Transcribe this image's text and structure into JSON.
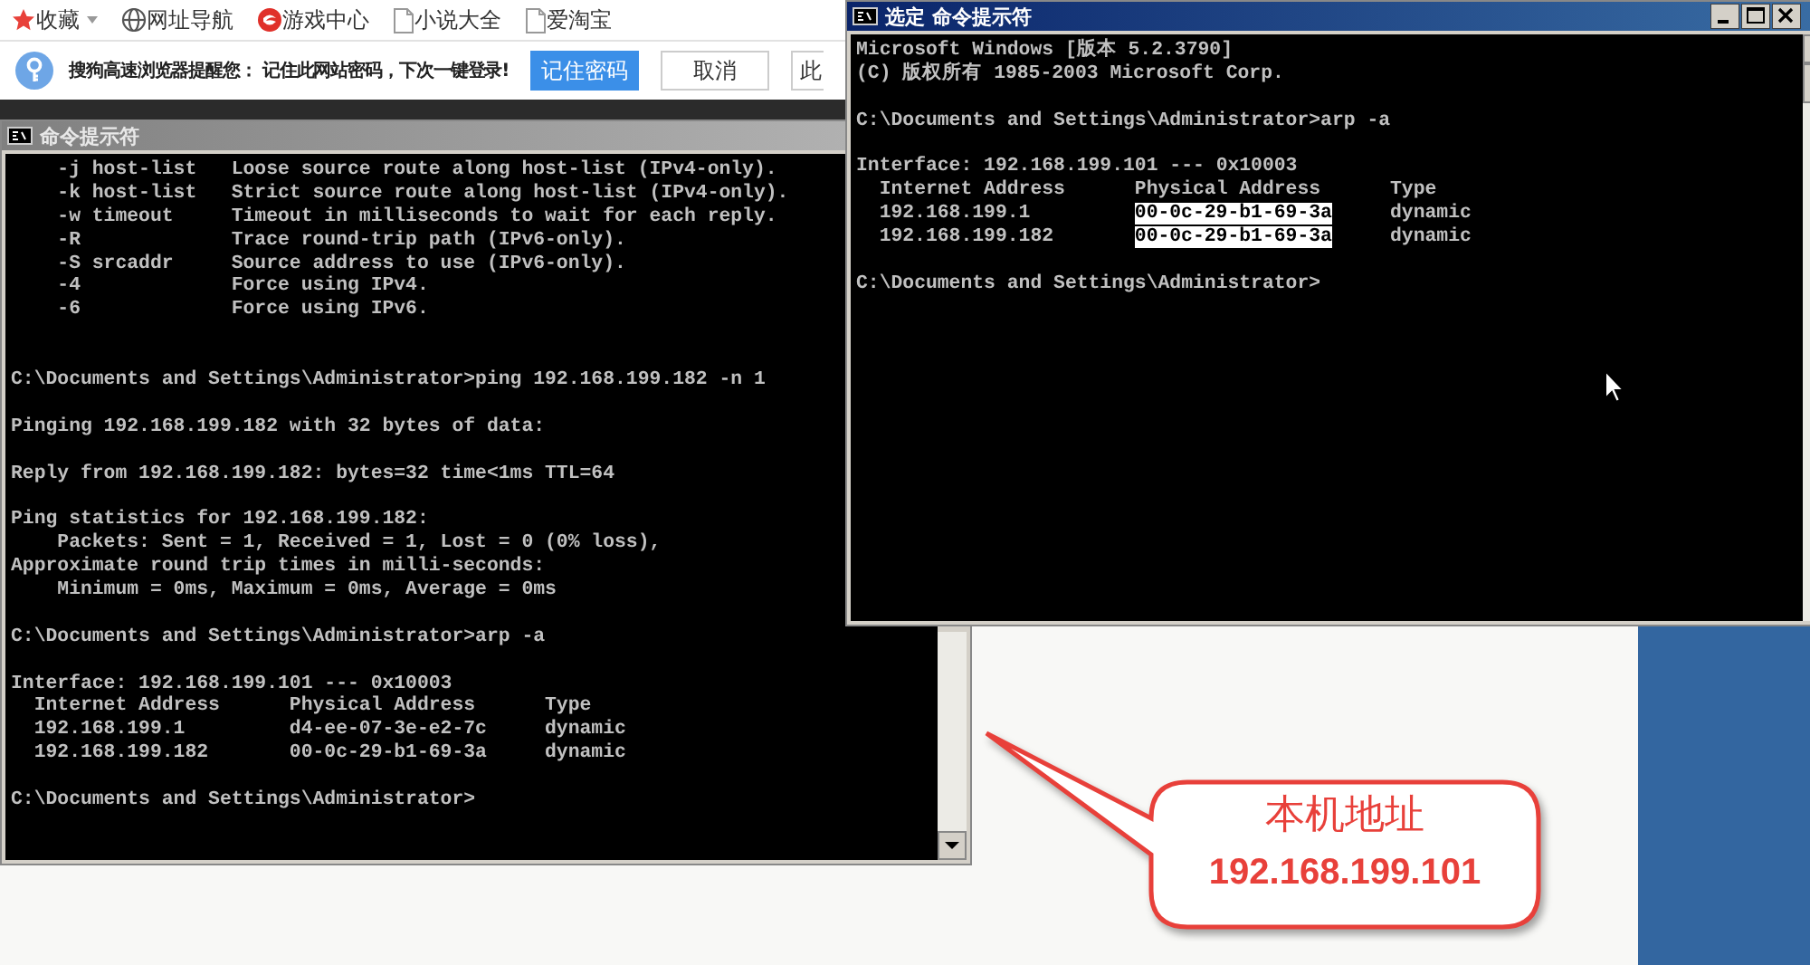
{
  "bookmarks_bar": {
    "items": [
      {
        "label": "收藏",
        "kind": "favorites"
      },
      {
        "label": "网址导航",
        "kind": "globe"
      },
      {
        "label": "游戏中心",
        "kind": "game"
      },
      {
        "label": "小说大全",
        "kind": "page"
      },
      {
        "label": "爱淘宝",
        "kind": "page"
      }
    ]
  },
  "notification": {
    "message": "搜狗高速浏览器提醒您： 记住此网站密码，下次一键登录!",
    "buttons": [
      {
        "label": "记住密码",
        "primary": true
      },
      {
        "label": "取消",
        "primary": false
      },
      {
        "label": "此",
        "primary": false
      }
    ]
  },
  "console_windows": [
    {
      "title": "命令提示符",
      "active": false,
      "lines": [
        {
          "kind": "text",
          "text": "    -j host-list   Loose source route along host-list (IPv4-only)."
        },
        {
          "kind": "text",
          "text": "    -k host-list   Strict source route along host-list (IPv4-only)."
        },
        {
          "kind": "text",
          "text": "    -w timeout     Timeout in milliseconds to wait for each reply."
        },
        {
          "kind": "text",
          "text": "    -R             Trace round-trip path (IPv6-only)."
        },
        {
          "kind": "text",
          "text": "    -S srcaddr     Source address to use (IPv6-only)."
        },
        {
          "kind": "text",
          "text": "    -4             Force using IPv4."
        },
        {
          "kind": "text",
          "text": "    -6             Force using IPv6."
        },
        {
          "kind": "blank"
        },
        {
          "kind": "blank"
        },
        {
          "kind": "text",
          "text": "C:\\Documents and Settings\\Administrator>ping 192.168.199.182 -n 1"
        },
        {
          "kind": "blank"
        },
        {
          "kind": "text",
          "text": "Pinging 192.168.199.182 with 32 bytes of data:"
        },
        {
          "kind": "blank"
        },
        {
          "kind": "text",
          "text": "Reply from 192.168.199.182: bytes=32 time<1ms TTL=64"
        },
        {
          "kind": "blank"
        },
        {
          "kind": "text",
          "text": "Ping statistics for 192.168.199.182:"
        },
        {
          "kind": "text",
          "text": "    Packets: Sent = 1, Received = 1, Lost = 0 (0% loss),"
        },
        {
          "kind": "text",
          "text": "Approximate round trip times in milli-seconds:"
        },
        {
          "kind": "text",
          "text": "    Minimum = 0ms, Maximum = 0ms, Average = 0ms"
        },
        {
          "kind": "blank"
        },
        {
          "kind": "text",
          "text": "C:\\Documents and Settings\\Administrator>arp -a"
        },
        {
          "kind": "blank"
        },
        {
          "kind": "text",
          "text": "Interface: 192.168.199.101 --- 0x10003"
        },
        {
          "kind": "text",
          "text": "  Internet Address      Physical Address      Type"
        },
        {
          "kind": "text",
          "text": "  192.168.199.1         d4-ee-07-3e-e2-7c     dynamic"
        },
        {
          "kind": "text",
          "text": "  192.168.199.182       00-0c-29-b1-69-3a     dynamic"
        },
        {
          "kind": "blank"
        },
        {
          "kind": "text",
          "text": "C:\\Documents and Settings\\Administrator>"
        }
      ]
    },
    {
      "title": "命令提示符",
      "mode_label": "选定",
      "active": true,
      "lines": [
        {
          "kind": "text",
          "text": "Microsoft Windows [版本 5.2.3790]"
        },
        {
          "kind": "text",
          "text": "(C) 版权所有 1985-2003 Microsoft Corp."
        },
        {
          "kind": "blank"
        },
        {
          "kind": "text",
          "text": "C:\\Documents and Settings\\Administrator>arp -a"
        },
        {
          "kind": "blank"
        },
        {
          "kind": "text",
          "text": "Interface: 192.168.199.101 --- 0x10003"
        },
        {
          "kind": "text",
          "text": "  Internet Address      Physical Address      Type"
        },
        {
          "kind": "row",
          "cells": [
            {
              "text": "192.168.199.1",
              "selected": false
            },
            {
              "text": "00-0c-29-b1-69-3a",
              "selected": true
            },
            {
              "text": "dynamic",
              "selected": false
            }
          ]
        },
        {
          "kind": "row",
          "cells": [
            {
              "text": "192.168.199.182",
              "selected": false
            },
            {
              "text": "00-0c-29-b1-69-3a",
              "selected": true
            },
            {
              "text": "dynamic",
              "selected": false
            }
          ]
        },
        {
          "kind": "blank"
        },
        {
          "kind": "text",
          "text": "C:\\Documents and Settings\\Administrator>"
        }
      ]
    }
  ],
  "callout": {
    "title": "本机地址",
    "address": "192.168.199.101"
  }
}
